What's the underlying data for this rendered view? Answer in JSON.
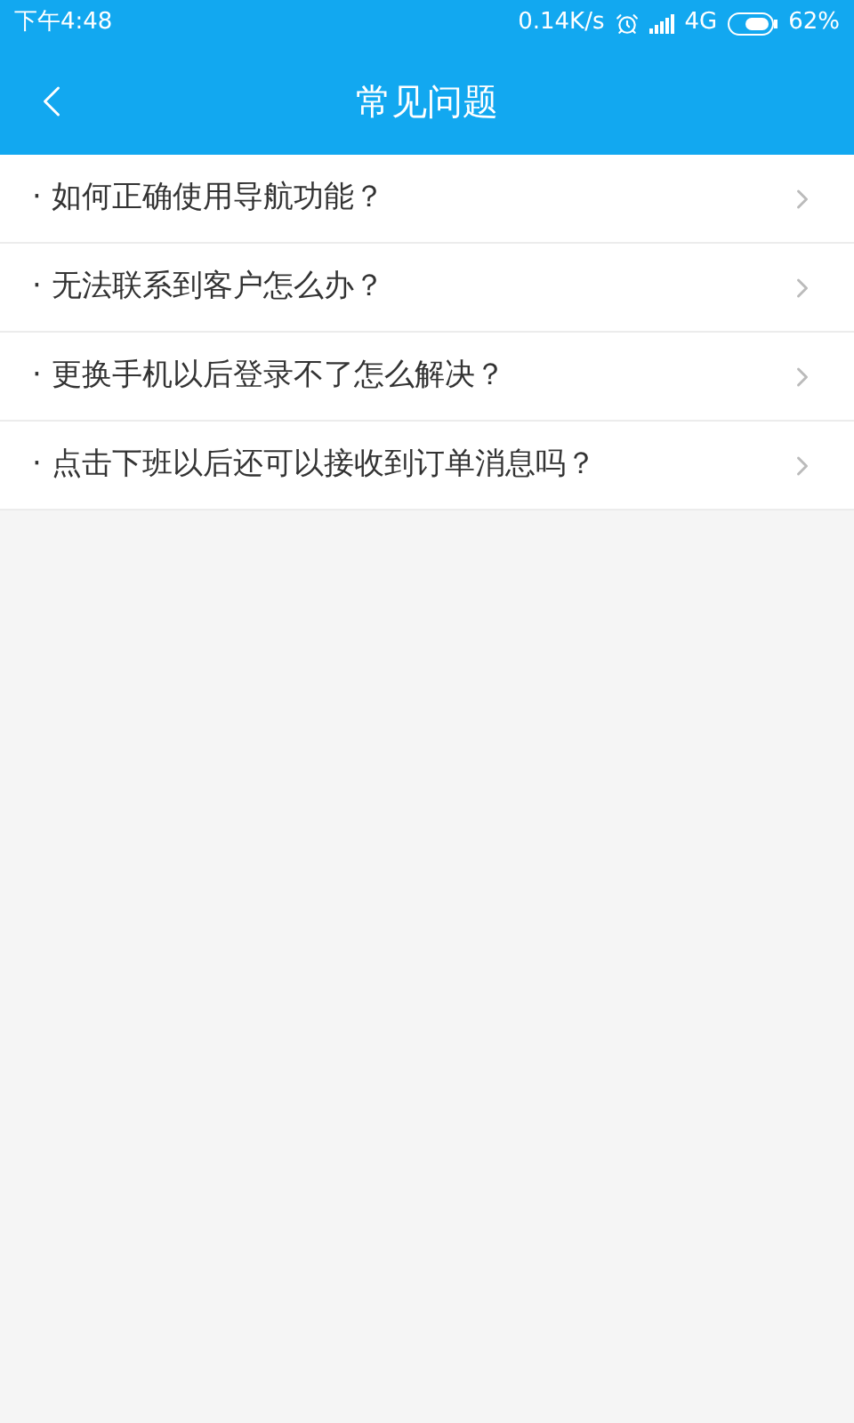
{
  "status_bar": {
    "time": "下午4:48",
    "speed": "0.14K/s",
    "network": "4G",
    "battery": "62%"
  },
  "header": {
    "title": "常见问题"
  },
  "faq": [
    {
      "text": "· 如何正确使用导航功能？"
    },
    {
      "text": "· 无法联系到客户怎么办？"
    },
    {
      "text": "· 更换手机以后登录不了怎么解决？"
    },
    {
      "text": "· 点击下班以后还可以接收到订单消息吗？"
    }
  ]
}
